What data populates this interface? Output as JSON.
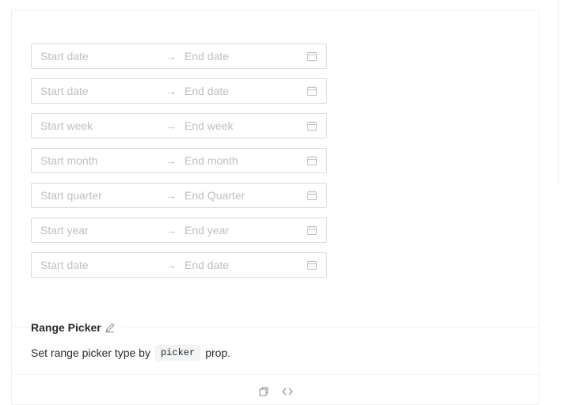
{
  "pickers": [
    {
      "start": "Start date",
      "end": "End date"
    },
    {
      "start": "Start date",
      "end": "End date"
    },
    {
      "start": "Start week",
      "end": "End week"
    },
    {
      "start": "Start month",
      "end": "End month"
    },
    {
      "start": "Start quarter",
      "end": "End Quarter"
    },
    {
      "start": "Start year",
      "end": "End year"
    },
    {
      "start": "Start date",
      "end": "End date"
    }
  ],
  "separator": "→",
  "meta": {
    "title": "Range Picker",
    "desc_before": "Set range picker type by",
    "code": "picker",
    "desc_after": "prop."
  },
  "icons": {
    "calendar": "calendar-icon",
    "separator": "arrow-right-icon",
    "edit": "edit-icon",
    "copy": "copy-icon",
    "code": "code-icon"
  },
  "colors": {
    "border": "#d9d9d9",
    "placeholder": "#bfbfbf",
    "divider": "#f0f0f0"
  }
}
